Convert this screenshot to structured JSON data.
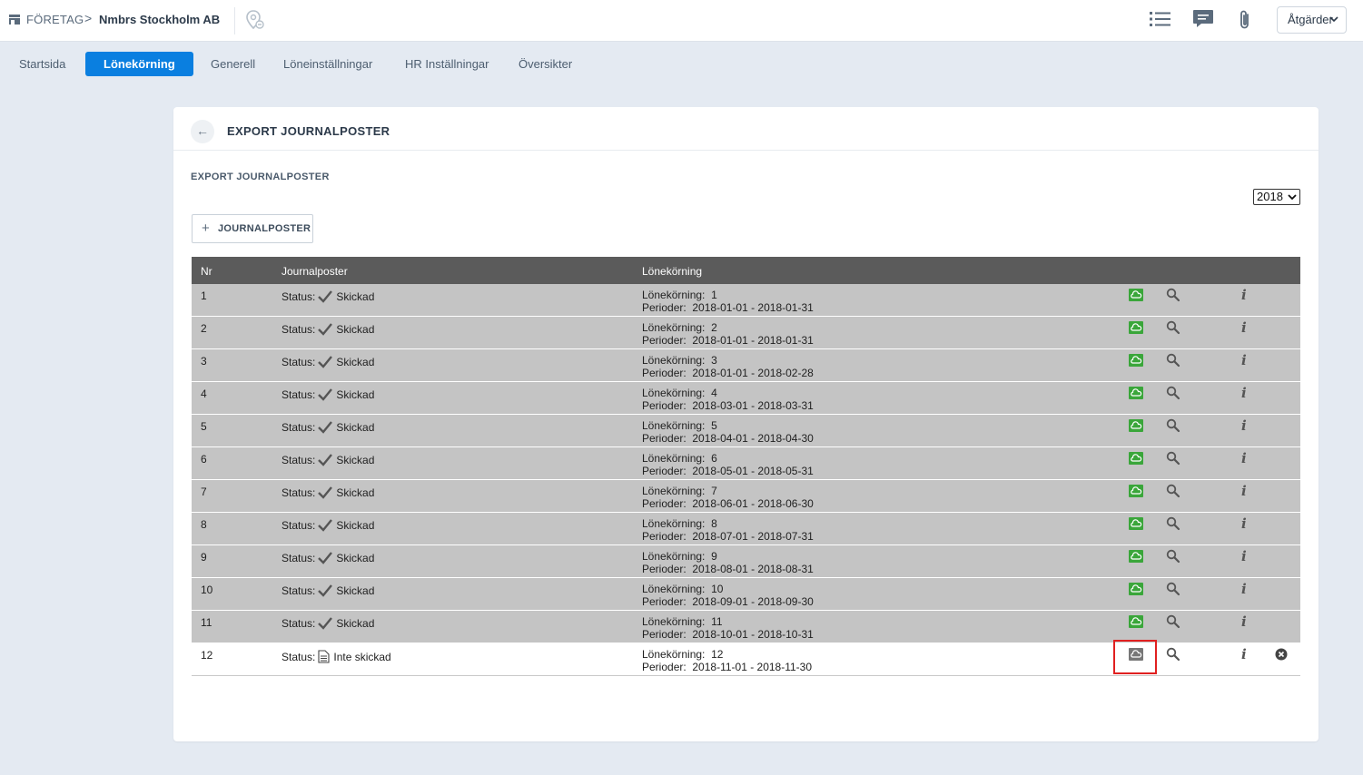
{
  "topbar": {
    "company_label": "FÖRETAG",
    "separator": ">",
    "company_name": "Nmbrs Stockholm AB",
    "actions_label": "Åtgärder"
  },
  "nav": {
    "tabs": [
      {
        "label": "Startsida",
        "active": false
      },
      {
        "label": "Lönekörning",
        "active": true
      },
      {
        "label": "Generell",
        "active": false
      },
      {
        "label": "Löneinställningar",
        "active": false
      },
      {
        "label": "HR Inställningar",
        "active": false
      },
      {
        "label": "Översikter",
        "active": false
      }
    ]
  },
  "card": {
    "back_arrow": "←",
    "title": "EXPORT JOURNALPOSTER",
    "section_title": "EXPORT JOURNALPOSTER",
    "year_value": "2018",
    "add_button_plus": "+",
    "add_button_label": "JOURNALPOSTER"
  },
  "table": {
    "headers": {
      "nr": "Nr",
      "journalposter": "Journalposter",
      "lonekorning": "Lönekörning"
    },
    "status_label": "Status:",
    "lk_label": "Lönekörning:",
    "period_label": "Perioder:",
    "info_glyph": "i",
    "rows": [
      {
        "nr": "1",
        "status": "Skickad",
        "sent": true,
        "lk": "1",
        "period": "2018-01-01 - 2018-01-31"
      },
      {
        "nr": "2",
        "status": "Skickad",
        "sent": true,
        "lk": "2",
        "period": "2018-01-01 - 2018-01-31"
      },
      {
        "nr": "3",
        "status": "Skickad",
        "sent": true,
        "lk": "3",
        "period": "2018-01-01 - 2018-02-28"
      },
      {
        "nr": "4",
        "status": "Skickad",
        "sent": true,
        "lk": "4",
        "period": "2018-03-01 - 2018-03-31"
      },
      {
        "nr": "5",
        "status": "Skickad",
        "sent": true,
        "lk": "5",
        "period": "2018-04-01 - 2018-04-30"
      },
      {
        "nr": "6",
        "status": "Skickad",
        "sent": true,
        "lk": "6",
        "period": "2018-05-01 - 2018-05-31"
      },
      {
        "nr": "7",
        "status": "Skickad",
        "sent": true,
        "lk": "7",
        "period": "2018-06-01 - 2018-06-30"
      },
      {
        "nr": "8",
        "status": "Skickad",
        "sent": true,
        "lk": "8",
        "period": "2018-07-01 - 2018-07-31"
      },
      {
        "nr": "9",
        "status": "Skickad",
        "sent": true,
        "lk": "9",
        "period": "2018-08-01 - 2018-08-31"
      },
      {
        "nr": "10",
        "status": "Skickad",
        "sent": true,
        "lk": "10",
        "period": "2018-09-01 - 2018-09-30"
      },
      {
        "nr": "11",
        "status": "Skickad",
        "sent": true,
        "lk": "11",
        "period": "2018-10-01 - 2018-10-31"
      },
      {
        "nr": "12",
        "status": "Inte skickad",
        "sent": false,
        "lk": "12",
        "period": "2018-11-01 - 2018-11-30"
      }
    ]
  },
  "colors": {
    "accent": "#0a7fe0",
    "sent_cloud": "#3aa63a",
    "unsent_cloud": "#777777",
    "highlight": "#e02020"
  }
}
